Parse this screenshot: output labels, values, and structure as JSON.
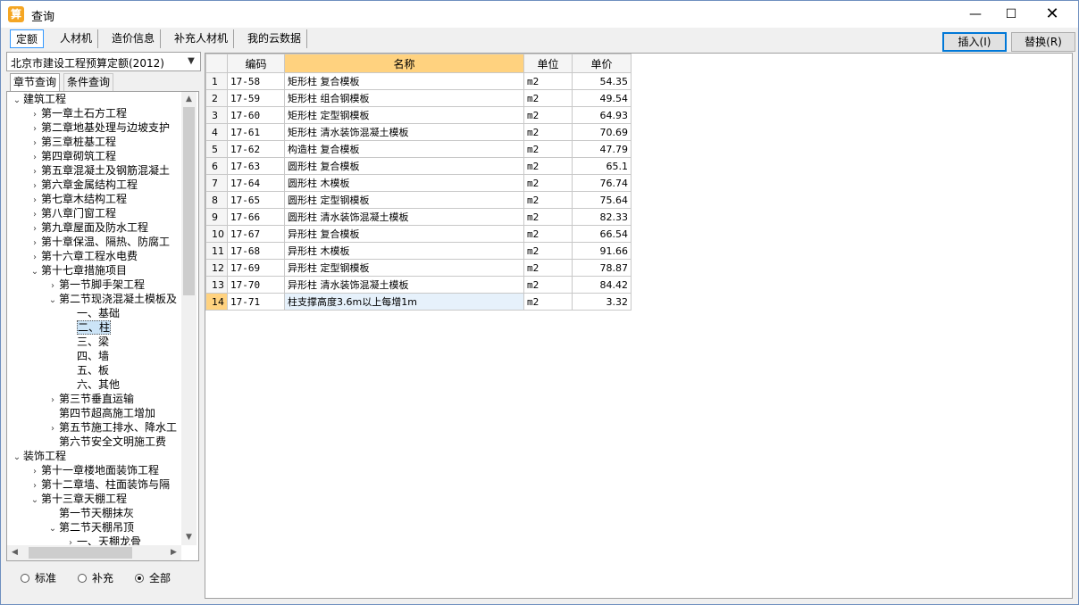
{
  "window": {
    "title": "查询"
  },
  "tabs": [
    {
      "label": "定额",
      "active": true
    },
    {
      "label": "人材机",
      "active": false
    },
    {
      "label": "造价信息",
      "active": false
    },
    {
      "label": "补充人材机",
      "active": false
    },
    {
      "label": "我的云数据",
      "active": false
    }
  ],
  "buttons": {
    "insert": "插入(I)",
    "replace": "替换(R)"
  },
  "quota_select": {
    "value": "北京市建设工程预算定额(2012)"
  },
  "subtabs": {
    "chapter": "章节查询",
    "condition": "条件查询"
  },
  "tree": [
    {
      "label": "建筑工程",
      "level": 0,
      "arrow": "down"
    },
    {
      "label": "第一章土石方工程",
      "level": 1,
      "arrow": "right"
    },
    {
      "label": "第二章地基处理与边坡支护",
      "level": 1,
      "arrow": "right"
    },
    {
      "label": "第三章桩基工程",
      "level": 1,
      "arrow": "right"
    },
    {
      "label": "第四章砌筑工程",
      "level": 1,
      "arrow": "right"
    },
    {
      "label": "第五章混凝土及钢筋混凝土",
      "level": 1,
      "arrow": "right"
    },
    {
      "label": "第六章金属结构工程",
      "level": 1,
      "arrow": "right"
    },
    {
      "label": "第七章木结构工程",
      "level": 1,
      "arrow": "right"
    },
    {
      "label": "第八章门窗工程",
      "level": 1,
      "arrow": "right"
    },
    {
      "label": "第九章屋面及防水工程",
      "level": 1,
      "arrow": "right"
    },
    {
      "label": "第十章保温、隔热、防腐工",
      "level": 1,
      "arrow": "right"
    },
    {
      "label": "第十六章工程水电费",
      "level": 1,
      "arrow": "right"
    },
    {
      "label": "第十七章措施项目",
      "level": 1,
      "arrow": "down"
    },
    {
      "label": "第一节脚手架工程",
      "level": 2,
      "arrow": "right"
    },
    {
      "label": "第二节现浇混凝土模板及",
      "level": 2,
      "arrow": "down"
    },
    {
      "label": "一、基础",
      "level": 3,
      "arrow": ""
    },
    {
      "label": "二、柱",
      "level": 3,
      "arrow": "",
      "selected": true
    },
    {
      "label": "三、梁",
      "level": 3,
      "arrow": ""
    },
    {
      "label": "四、墙",
      "level": 3,
      "arrow": ""
    },
    {
      "label": "五、板",
      "level": 3,
      "arrow": ""
    },
    {
      "label": "六、其他",
      "level": 3,
      "arrow": ""
    },
    {
      "label": "第三节垂直运输",
      "level": 2,
      "arrow": "right"
    },
    {
      "label": "第四节超高施工增加",
      "level": 2,
      "arrow": ""
    },
    {
      "label": "第五节施工排水、降水工",
      "level": 2,
      "arrow": "right"
    },
    {
      "label": "第六节安全文明施工费",
      "level": 2,
      "arrow": ""
    },
    {
      "label": "装饰工程",
      "level": 0,
      "arrow": "down"
    },
    {
      "label": "第十一章楼地面装饰工程",
      "level": 1,
      "arrow": "right"
    },
    {
      "label": "第十二章墙、柱面装饰与隔",
      "level": 1,
      "arrow": "right"
    },
    {
      "label": "第十三章天棚工程",
      "level": 1,
      "arrow": "down"
    },
    {
      "label": "第一节天棚抹灰",
      "level": 2,
      "arrow": ""
    },
    {
      "label": "第二节天棚吊顶",
      "level": 2,
      "arrow": "down"
    },
    {
      "label": "一、天棚龙骨",
      "level": 3,
      "arrow": "right"
    }
  ],
  "radios": [
    {
      "label": "标准",
      "checked": false
    },
    {
      "label": "补充",
      "checked": false
    },
    {
      "label": "全部",
      "checked": true
    }
  ],
  "grid": {
    "headers": [
      "",
      "编码",
      "名称",
      "单位",
      "单价"
    ],
    "rows": [
      {
        "n": "1",
        "code": "17-58",
        "name": "矩形柱 复合模板",
        "unit": "m2",
        "price": "54.35"
      },
      {
        "n": "2",
        "code": "17-59",
        "name": "矩形柱 组合钢模板",
        "unit": "m2",
        "price": "49.54"
      },
      {
        "n": "3",
        "code": "17-60",
        "name": "矩形柱 定型钢模板",
        "unit": "m2",
        "price": "64.93"
      },
      {
        "n": "4",
        "code": "17-61",
        "name": "矩形柱 清水装饰混凝土模板",
        "unit": "m2",
        "price": "70.69"
      },
      {
        "n": "5",
        "code": "17-62",
        "name": "构造柱 复合模板",
        "unit": "m2",
        "price": "47.79"
      },
      {
        "n": "6",
        "code": "17-63",
        "name": "圆形柱 复合模板",
        "unit": "m2",
        "price": "65.1"
      },
      {
        "n": "7",
        "code": "17-64",
        "name": "圆形柱 木模板",
        "unit": "m2",
        "price": "76.74"
      },
      {
        "n": "8",
        "code": "17-65",
        "name": "圆形柱 定型钢模板",
        "unit": "m2",
        "price": "75.64"
      },
      {
        "n": "9",
        "code": "17-66",
        "name": "圆形柱 清水装饰混凝土模板",
        "unit": "m2",
        "price": "82.33"
      },
      {
        "n": "10",
        "code": "17-67",
        "name": "异形柱 复合模板",
        "unit": "m2",
        "price": "66.54"
      },
      {
        "n": "11",
        "code": "17-68",
        "name": "异形柱 木模板",
        "unit": "m2",
        "price": "91.66"
      },
      {
        "n": "12",
        "code": "17-69",
        "name": "异形柱 定型钢模板",
        "unit": "m2",
        "price": "78.87"
      },
      {
        "n": "13",
        "code": "17-70",
        "name": "异形柱 清水装饰混凝土模板",
        "unit": "m2",
        "price": "84.42"
      },
      {
        "n": "14",
        "code": "17-71",
        "name": "柱支撑高度3.6m以上每增1m",
        "unit": "m2",
        "price": "3.32",
        "selected": true
      }
    ]
  }
}
